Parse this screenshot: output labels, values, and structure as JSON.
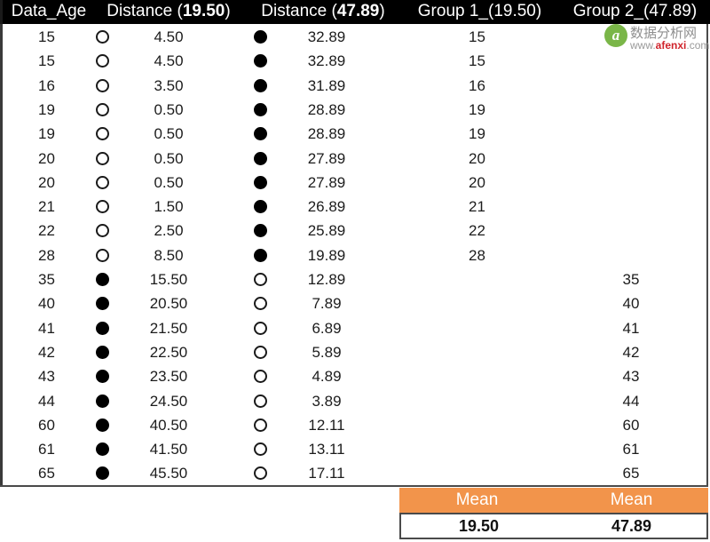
{
  "table": {
    "columns": [
      {
        "key": "data_age",
        "label": "Data_Age"
      },
      {
        "key": "distance_1",
        "label_prefix": "Distance (",
        "label_value": "19.50",
        "label_suffix": ")"
      },
      {
        "key": "distance_2",
        "label_prefix": "Distance (",
        "label_value": "47.89",
        "label_suffix": ")"
      },
      {
        "key": "group_1",
        "label_prefix": "Group 1_(",
        "label_value": "19.50",
        "label_suffix": ")"
      },
      {
        "key": "group_2",
        "label_prefix": "Group 2_(",
        "label_value": "47.89",
        "label_suffix": ")"
      }
    ],
    "headers": {
      "data_age": "Data_Age",
      "distance_1_pre": "Distance (",
      "distance_1_val": "19.50",
      "distance_1_post": ")",
      "distance_2_pre": "Distance (",
      "distance_2_val": "47.89",
      "distance_2_post": ")",
      "group_1_pre": "Group 1_(",
      "group_1_val": "19.50",
      "group_1_post": ")",
      "group_2_pre": "Group 2_(",
      "group_2_val": "47.89",
      "group_2_post": ")"
    },
    "rows": [
      {
        "data_age": "15",
        "marker_1": "open",
        "distance_1": "4.50",
        "marker_2": "filled",
        "distance_2": "32.89",
        "group_1": "15",
        "group_2": ""
      },
      {
        "data_age": "15",
        "marker_1": "open",
        "distance_1": "4.50",
        "marker_2": "filled",
        "distance_2": "32.89",
        "group_1": "15",
        "group_2": ""
      },
      {
        "data_age": "16",
        "marker_1": "open",
        "distance_1": "3.50",
        "marker_2": "filled",
        "distance_2": "31.89",
        "group_1": "16",
        "group_2": ""
      },
      {
        "data_age": "19",
        "marker_1": "open",
        "distance_1": "0.50",
        "marker_2": "filled",
        "distance_2": "28.89",
        "group_1": "19",
        "group_2": ""
      },
      {
        "data_age": "19",
        "marker_1": "open",
        "distance_1": "0.50",
        "marker_2": "filled",
        "distance_2": "28.89",
        "group_1": "19",
        "group_2": ""
      },
      {
        "data_age": "20",
        "marker_1": "open",
        "distance_1": "0.50",
        "marker_2": "filled",
        "distance_2": "27.89",
        "group_1": "20",
        "group_2": ""
      },
      {
        "data_age": "20",
        "marker_1": "open",
        "distance_1": "0.50",
        "marker_2": "filled",
        "distance_2": "27.89",
        "group_1": "20",
        "group_2": ""
      },
      {
        "data_age": "21",
        "marker_1": "open",
        "distance_1": "1.50",
        "marker_2": "filled",
        "distance_2": "26.89",
        "group_1": "21",
        "group_2": ""
      },
      {
        "data_age": "22",
        "marker_1": "open",
        "distance_1": "2.50",
        "marker_2": "filled",
        "distance_2": "25.89",
        "group_1": "22",
        "group_2": ""
      },
      {
        "data_age": "28",
        "marker_1": "open",
        "distance_1": "8.50",
        "marker_2": "filled",
        "distance_2": "19.89",
        "group_1": "28",
        "group_2": ""
      },
      {
        "data_age": "35",
        "marker_1": "filled",
        "distance_1": "15.50",
        "marker_2": "open",
        "distance_2": "12.89",
        "group_1": "",
        "group_2": "35"
      },
      {
        "data_age": "40",
        "marker_1": "filled",
        "distance_1": "20.50",
        "marker_2": "open",
        "distance_2": "7.89",
        "group_1": "",
        "group_2": "40"
      },
      {
        "data_age": "41",
        "marker_1": "filled",
        "distance_1": "21.50",
        "marker_2": "open",
        "distance_2": "6.89",
        "group_1": "",
        "group_2": "41"
      },
      {
        "data_age": "42",
        "marker_1": "filled",
        "distance_1": "22.50",
        "marker_2": "open",
        "distance_2": "5.89",
        "group_1": "",
        "group_2": "42"
      },
      {
        "data_age": "43",
        "marker_1": "filled",
        "distance_1": "23.50",
        "marker_2": "open",
        "distance_2": "4.89",
        "group_1": "",
        "group_2": "43"
      },
      {
        "data_age": "44",
        "marker_1": "filled",
        "distance_1": "24.50",
        "marker_2": "open",
        "distance_2": "3.89",
        "group_1": "",
        "group_2": "44"
      },
      {
        "data_age": "60",
        "marker_1": "filled",
        "distance_1": "40.50",
        "marker_2": "open",
        "distance_2": "12.11",
        "group_1": "",
        "group_2": "60"
      },
      {
        "data_age": "61",
        "marker_1": "filled",
        "distance_1": "41.50",
        "marker_2": "open",
        "distance_2": "13.11",
        "group_1": "",
        "group_2": "61"
      },
      {
        "data_age": "65",
        "marker_1": "filled",
        "distance_1": "45.50",
        "marker_2": "open",
        "distance_2": "17.11",
        "group_1": "",
        "group_2": "65"
      }
    ]
  },
  "summary": {
    "mean_label_1": "Mean",
    "mean_label_2": "Mean",
    "mean_value_1": "19.50",
    "mean_value_2": "47.89"
  },
  "watermark": {
    "logo_letter": "a",
    "chinese_text": "数据分析网",
    "url_prefix": "www.",
    "url_brand": "afenxi",
    "url_suffix": ".com"
  },
  "colors": {
    "header_background": "#000000",
    "header_text": "#ffffff",
    "column_shade": "#f0f0f0",
    "mean_band": "#F2944B",
    "marker_filled": "#000000",
    "marker_open_border": "#1a1a1a",
    "page_background": "#ffffff"
  }
}
